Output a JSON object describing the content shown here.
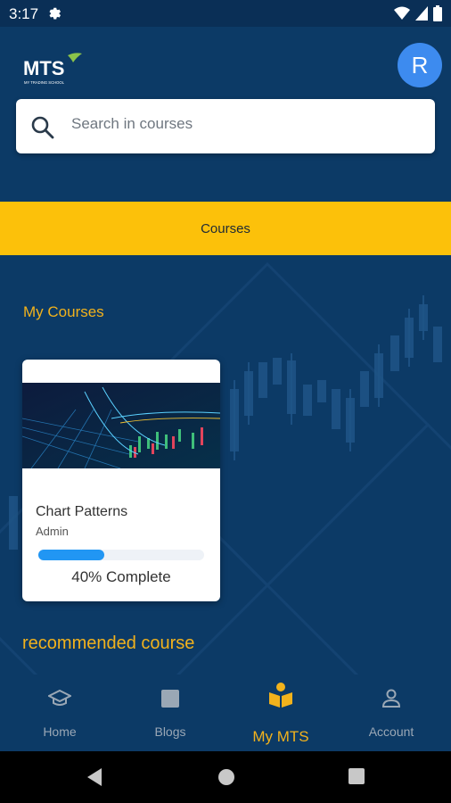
{
  "status_bar": {
    "time": "3:17"
  },
  "header": {
    "logo_text": "MTS",
    "logo_subtitle": "MY TRADING SCHOOL",
    "avatar_initial": "R"
  },
  "search": {
    "placeholder": "Search in courses"
  },
  "tab_bar": {
    "label": "Courses"
  },
  "my_courses": {
    "title": "My Courses",
    "items": [
      {
        "title": "Chart Patterns",
        "author": "Admin",
        "progress_percent": 40,
        "progress_text": "40% Complete"
      }
    ]
  },
  "recommended": {
    "title": "recommended course"
  },
  "bottom_nav": {
    "items": [
      {
        "label": "Home",
        "icon": "graduation-cap-icon"
      },
      {
        "label": "Blogs",
        "icon": "square-icon"
      },
      {
        "label": "My MTS",
        "icon": "open-book-icon",
        "active": true
      },
      {
        "label": "Account",
        "icon": "person-icon"
      }
    ]
  },
  "colors": {
    "primary_bg": "#0c3a66",
    "accent": "#fcc10a",
    "progress": "#2196f3",
    "avatar": "#3d8bef"
  }
}
